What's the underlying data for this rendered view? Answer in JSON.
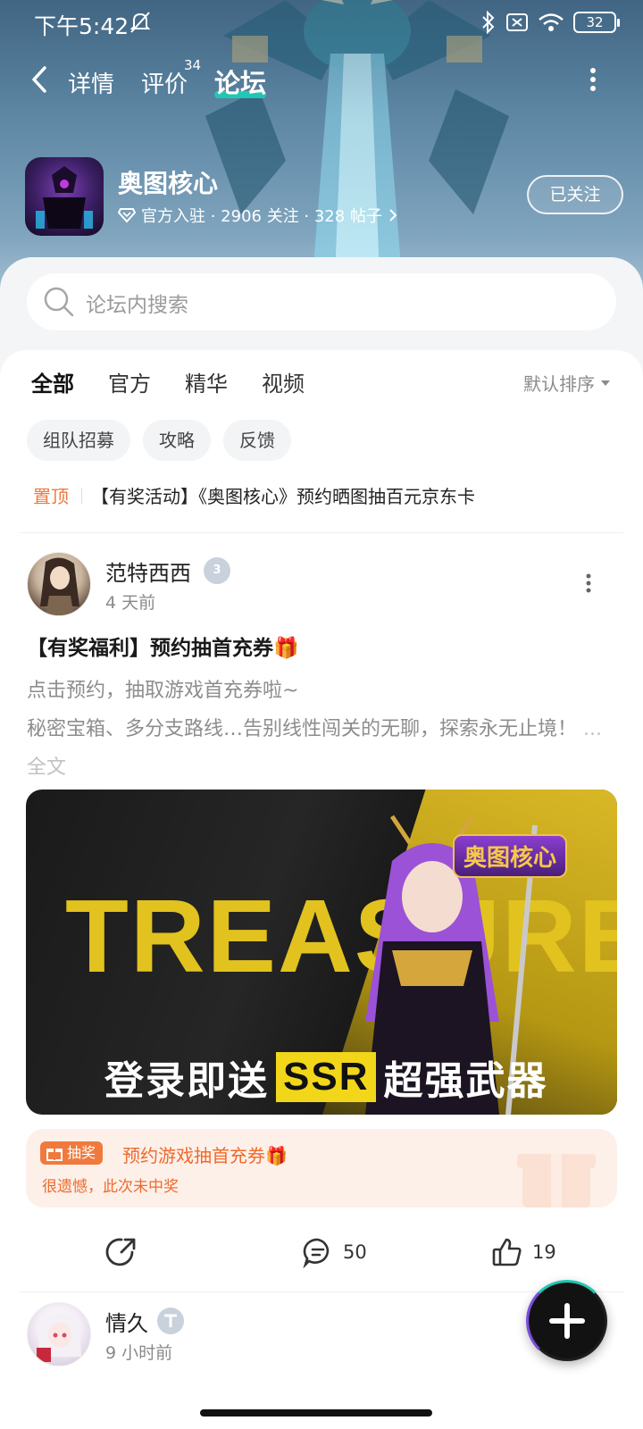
{
  "status_bar": {
    "time": "下午5:42",
    "battery": "32"
  },
  "nav": {
    "tabs": [
      {
        "label": "详情"
      },
      {
        "label": "评价",
        "badge": "34"
      },
      {
        "label": "论坛",
        "selected": true
      }
    ]
  },
  "game": {
    "name": "奥图核心",
    "meta": "官方入驻 · 2906 关注 · 328 帖子",
    "follow_label": "已关注"
  },
  "search": {
    "placeholder": "论坛内搜索"
  },
  "filter_tabs": [
    "全部",
    "官方",
    "精华",
    "视频"
  ],
  "sort_label": "默认排序",
  "chips": [
    "组队招募",
    "攻略",
    "反馈"
  ],
  "pinned": {
    "tag": "置顶",
    "text": "【有奖活动】《奥图核心》预约晒图抽百元京东卡"
  },
  "post": {
    "author": "范特西西",
    "level": "3",
    "time": "4 天前",
    "title": "【有奖福利】预约抽首充券🎁",
    "body_line1": "点击预约，抽取游戏首充券啦~",
    "body_line2": "秘密宝箱、多分支路线…告别线性闯关的无聊，探索永无止境！",
    "more": "... 全文",
    "banner": {
      "word": "TREASURE",
      "logo": "奥图核心",
      "caption_pre": "登录即送",
      "caption_ssr": "SSR",
      "caption_post": "超强武器"
    },
    "lottery": {
      "tag": "抽奖",
      "title": "预约游戏抽首充券🎁",
      "result": "很遗憾，此次未中奖"
    },
    "comments": "50",
    "likes": "19"
  },
  "post2": {
    "author": "情久",
    "time": "9 小时前"
  },
  "colors": {
    "accent": "#21c7b3",
    "orange": "#f07a3e"
  }
}
